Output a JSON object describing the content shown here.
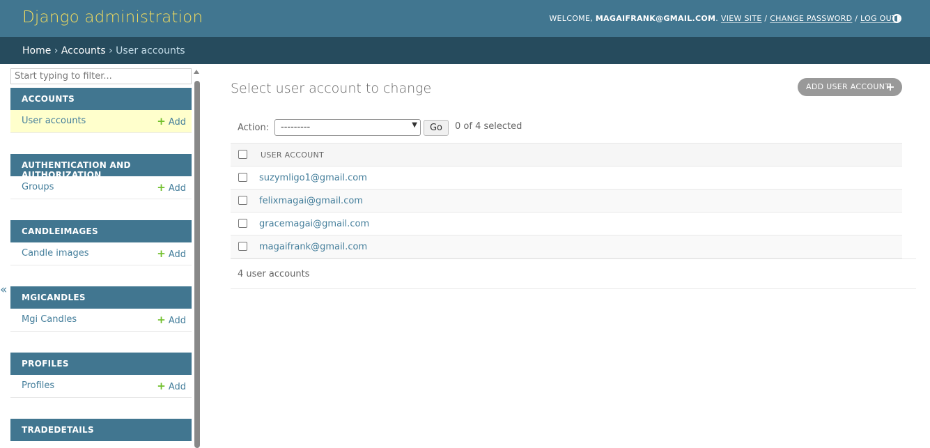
{
  "header": {
    "site_name": "Django administration",
    "welcome": "WELCOME, ",
    "username": "MAGAIFRANK@GMAIL.COM",
    "view_site": "VIEW SITE",
    "change_password": "CHANGE PASSWORD",
    "log_out": "LOG OUT",
    "sep": " / ",
    "theme_icon": "theme-toggle-icon"
  },
  "breadcrumbs": {
    "home": "Home",
    "accounts": "Accounts",
    "current": "User accounts",
    "sep": " › "
  },
  "sidebar": {
    "filter_placeholder": "Start typing to filter...",
    "add_label": "Add",
    "collapse_glyph": "«",
    "modules": [
      {
        "title": "ACCOUNTS",
        "model": "User accounts"
      },
      {
        "title": "AUTHENTICATION AND AUTHORIZATION",
        "model": "Groups"
      },
      {
        "title": "CANDLEIMAGES",
        "model": "Candle images"
      },
      {
        "title": "MGICANDLES",
        "model": "Mgi Candles"
      },
      {
        "title": "PROFILES",
        "model": "Profiles"
      },
      {
        "title": "TRADEDETAILS",
        "model": ""
      }
    ]
  },
  "content": {
    "title": "Select user account to change",
    "add_button": "ADD USER ACCOUNT",
    "action_label": "Action:",
    "action_selected": "---------",
    "go_label": "Go",
    "selected_count": "0 of 4 selected",
    "column_header": "USER ACCOUNT",
    "rows": [
      "suzymligo1@gmail.com",
      "felixmagai@gmail.com",
      "gracemagai@gmail.com",
      "magaifrank@gmail.com"
    ],
    "paginator": "4 user accounts"
  },
  "colors": {
    "header_bg": "#417690",
    "breadcrumb_bg": "#264b5d",
    "branding": "#f5dd5d",
    "link": "#447e9b",
    "add_icon": "#70bf2b",
    "current_row": "#ffffcc"
  }
}
